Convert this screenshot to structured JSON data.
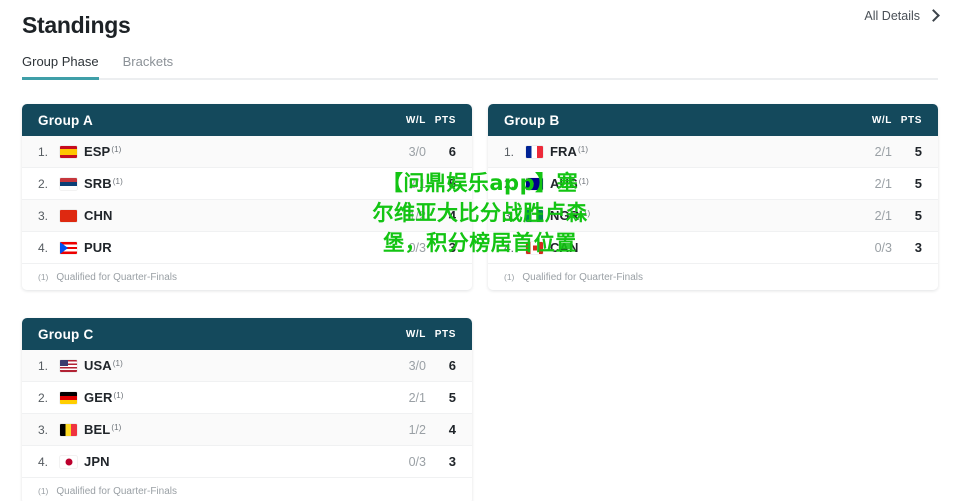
{
  "header": {
    "title": "Standings",
    "all_details_label": "All Details",
    "chevron_icon": "chevron-right-icon"
  },
  "tabs": [
    {
      "label": "Group Phase",
      "active": true
    },
    {
      "label": "Brackets",
      "active": false
    }
  ],
  "columns": {
    "wl": "W/L",
    "pts": "PTS"
  },
  "footnote": {
    "mark": "(1)",
    "text": "Qualified for Quarter-Finals"
  },
  "colors": {
    "card_header_bg": "#14495c",
    "tab_accent": "#3f9fa8",
    "page_bg": "#ffffff",
    "row_alt_bg": "#fafafa",
    "watermark": "#13c413"
  },
  "groups": [
    {
      "name": "Group A",
      "rows": [
        {
          "rank": "1.",
          "code": "ESP",
          "flag": "f-esp",
          "flag_name": "flag-spain",
          "qualified": "(1)",
          "wl": "3/0",
          "pts": "6"
        },
        {
          "rank": "2.",
          "code": "SRB",
          "flag": "f-srb",
          "flag_name": "flag-serbia",
          "qualified": "(1)",
          "wl": "2/1",
          "pts": "5"
        },
        {
          "rank": "3.",
          "code": "CHN",
          "flag": "f-chn",
          "flag_name": "flag-china",
          "qualified": "",
          "wl": "1/2",
          "pts": "4"
        },
        {
          "rank": "4.",
          "code": "PUR",
          "flag": "f-pur",
          "flag_name": "flag-puerto-rico",
          "qualified": "",
          "wl": "0/3",
          "pts": "3"
        }
      ]
    },
    {
      "name": "Group B",
      "rows": [
        {
          "rank": "1.",
          "code": "FRA",
          "flag": "f-fra",
          "flag_name": "flag-france",
          "qualified": "(1)",
          "wl": "2/1",
          "pts": "5"
        },
        {
          "rank": "2.",
          "code": "AUS",
          "flag": "f-aus",
          "flag_name": "flag-australia",
          "qualified": "(1)",
          "wl": "2/1",
          "pts": "5"
        },
        {
          "rank": "3.",
          "code": "NGR",
          "flag": "f-ngr",
          "flag_name": "flag-nigeria",
          "qualified": "(1)",
          "wl": "2/1",
          "pts": "5"
        },
        {
          "rank": "4.",
          "code": "CAN",
          "flag": "f-can",
          "flag_name": "flag-canada",
          "qualified": "",
          "wl": "0/3",
          "pts": "3"
        }
      ]
    },
    {
      "name": "Group C",
      "rows": [
        {
          "rank": "1.",
          "code": "USA",
          "flag": "f-usa",
          "flag_name": "flag-united-states",
          "qualified": "(1)",
          "wl": "3/0",
          "pts": "6"
        },
        {
          "rank": "2.",
          "code": "GER",
          "flag": "f-ger",
          "flag_name": "flag-germany",
          "qualified": "(1)",
          "wl": "2/1",
          "pts": "5"
        },
        {
          "rank": "3.",
          "code": "BEL",
          "flag": "f-bel",
          "flag_name": "flag-belgium",
          "qualified": "(1)",
          "wl": "1/2",
          "pts": "4"
        },
        {
          "rank": "4.",
          "code": "JPN",
          "flag": "f-jpn",
          "flag_name": "flag-japan",
          "qualified": "",
          "wl": "0/3",
          "pts": "3"
        }
      ]
    }
  ],
  "watermark": {
    "lines": [
      "【问鼎娱乐app】塞",
      "尔维亚大比分战胜卢森",
      "堡，积分榜居首位置"
    ]
  }
}
